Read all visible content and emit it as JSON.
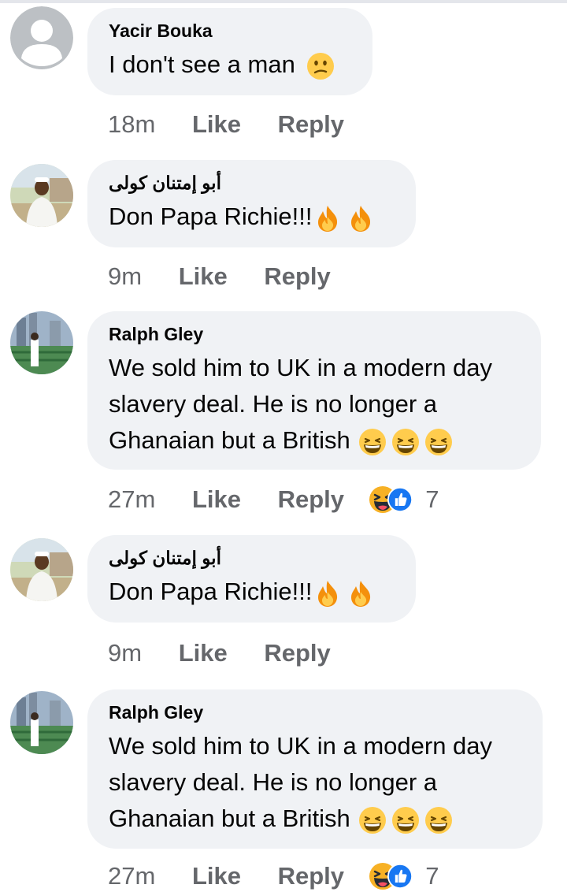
{
  "comments": [
    {
      "author": "Yacir Bouka",
      "text": "I don't see a man",
      "emojis": [
        "confused-face"
      ],
      "time": "18m",
      "like": "Like",
      "reply": "Reply",
      "avatar": "default-avatar"
    },
    {
      "author": "أبو إمتنان كولى",
      "text": "Don Papa Richie!!!",
      "emojis": [
        "fire",
        "fire"
      ],
      "time": "9m",
      "like": "Like",
      "reply": "Reply",
      "avatar": "photo-avatar-white-outfit"
    },
    {
      "author": "Ralph Gley",
      "text": "We sold him to UK in a modern day slavery deal. He is no longer a Ghanaian but a British",
      "emojis": [
        "grinning-squinting-face",
        "grinning-squinting-face",
        "grinning-squinting-face"
      ],
      "time": "27m",
      "like": "Like",
      "reply": "Reply",
      "reactions": [
        "haha-reaction",
        "like-reaction"
      ],
      "reaction_count": "7",
      "avatar": "photo-avatar-green-fence"
    },
    {
      "author": "أبو إمتنان كولى",
      "text": "Don Papa Richie!!!",
      "emojis": [
        "fire",
        "fire"
      ],
      "time": "9m",
      "like": "Like",
      "reply": "Reply",
      "avatar": "photo-avatar-white-outfit"
    },
    {
      "author": "Ralph Gley",
      "text": "We sold him to UK in a modern day slavery deal. He is no longer a Ghanaian but a British",
      "emojis": [
        "grinning-squinting-face",
        "grinning-squinting-face",
        "grinning-squinting-face"
      ],
      "time": "27m",
      "like": "Like",
      "reply": "Reply",
      "reactions": [
        "haha-reaction",
        "like-reaction"
      ],
      "reaction_count": "7",
      "avatar": "photo-avatar-green-fence"
    }
  ],
  "colors": {
    "bubble": "#f0f2f5",
    "meta": "#65676b",
    "text": "#050505",
    "like_blue": "#1877f2"
  }
}
